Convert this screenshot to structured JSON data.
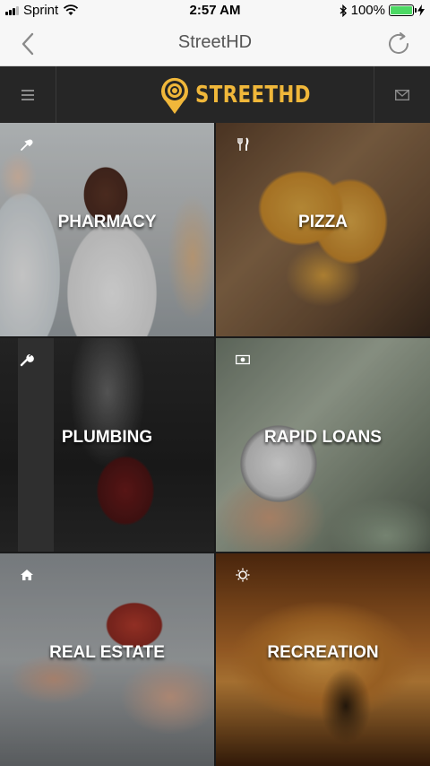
{
  "status_bar": {
    "carrier": "Sprint",
    "time": "2:57 AM",
    "battery": "100%",
    "battery_level": 1.0
  },
  "nav": {
    "title": "StreetHD"
  },
  "header": {
    "logo_text": "STREETHD"
  },
  "colors": {
    "accent": "#f0b73a",
    "header_bg": "#262626",
    "battery_green": "#4cd964"
  },
  "categories": [
    {
      "label": "PHARMACY",
      "icon": "dropper-icon"
    },
    {
      "label": "PIZZA",
      "icon": "utensils-icon"
    },
    {
      "label": "PLUMBING",
      "icon": "wrench-icon"
    },
    {
      "label": "RAPID LOANS",
      "icon": "money-icon"
    },
    {
      "label": "REAL ESTATE",
      "icon": "home-icon"
    },
    {
      "label": "RECREATION",
      "icon": "sun-icon"
    }
  ]
}
